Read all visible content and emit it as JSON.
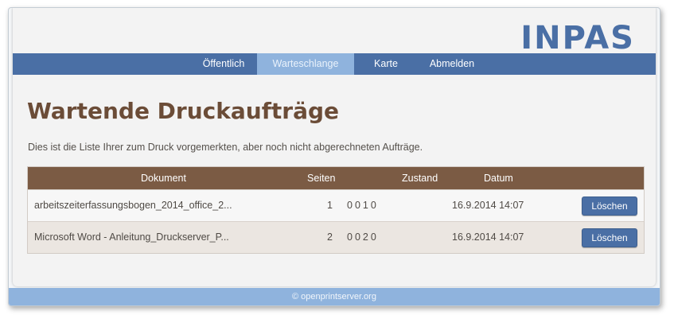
{
  "brand": {
    "logo_text": "INPAS"
  },
  "nav": {
    "items": [
      {
        "label": "Öffentlich"
      },
      {
        "label": "Warteschlange",
        "active": true
      },
      {
        "label": "Karte"
      },
      {
        "label": "Abmelden"
      }
    ]
  },
  "page": {
    "title": "Wartende Druckaufträge",
    "intro": "Dies ist die Liste Ihrer zum Druck vorgemerkten, aber noch nicht abgerechneten Aufträge."
  },
  "table": {
    "headers": {
      "document": "Dokument",
      "pages": "Seiten",
      "state": "Zustand",
      "date": "Datum"
    },
    "rows": [
      {
        "document": "arbeitszeiterfassungsbogen_2014_office_2...",
        "pages": "1",
        "state": "0010",
        "date": "16.9.2014 14:07",
        "delete_label": "Löschen"
      },
      {
        "document": "Microsoft Word - Anleitung_Druckserver_P...",
        "pages": "2",
        "state": "0020",
        "date": "16.9.2014 14:07",
        "delete_label": "Löschen"
      }
    ]
  },
  "footer": {
    "text": "© openprintserver.org"
  },
  "colors": {
    "brand_blue": "#4a6fa5",
    "active_nav": "#8fb3dd",
    "brown_header": "#7b5b44",
    "title_brown": "#6b4c37"
  }
}
